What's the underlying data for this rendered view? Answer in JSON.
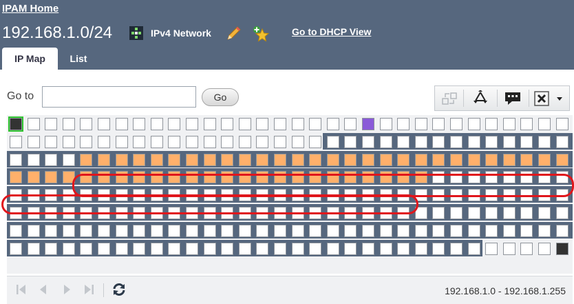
{
  "header": {
    "home_link": "IPAM Home",
    "network_title": "192.168.1.0/24",
    "network_type": "IPv4 Network",
    "dhcp_link": "Go to DHCP View",
    "icons": [
      "network-icon",
      "pencil-icon",
      "add-favorite-star-icon"
    ]
  },
  "tabs": [
    {
      "label": "IP Map",
      "active": true
    },
    {
      "label": "List",
      "active": false
    }
  ],
  "goto": {
    "label": "Go to",
    "value": "",
    "button": "Go"
  },
  "toolbar": {
    "icons": [
      "convert-icon",
      "recycle-icon",
      "comment-icon",
      "delete-icon",
      "dropdown-arrow-icon"
    ]
  },
  "ip_map": {
    "total_cells": 256,
    "selected_cell": 0,
    "highlighted_ranges": [
      {
        "from": 4,
        "to": 31,
        "color": "#ffb06b"
      },
      {
        "from": 32,
        "to": 55,
        "color": "#ffb06b"
      }
    ],
    "range_fill_color": "#56677e",
    "status_colors": {
      "dark": "#333333",
      "purple": "#8a5ad8",
      "free": "#ffffff"
    }
  },
  "footer": {
    "nav_icons": [
      "first-page-icon",
      "previous-page-icon",
      "next-page-icon",
      "last-page-icon",
      "refresh-icon"
    ],
    "range_text": "192.168.1.0 - 192.168.1.255"
  }
}
